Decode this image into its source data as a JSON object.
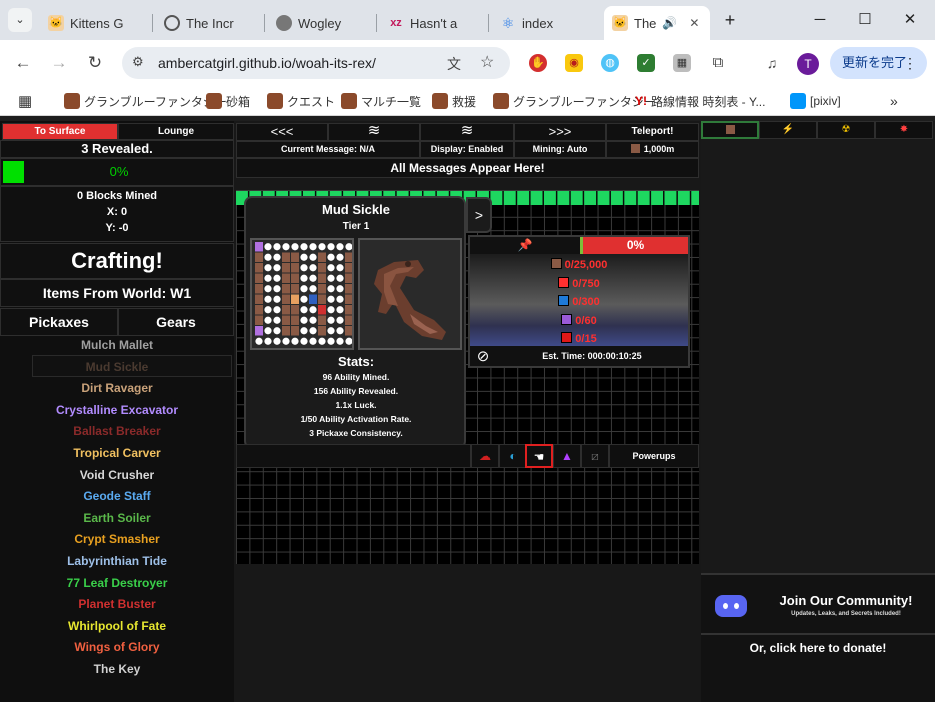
{
  "browser": {
    "tabs": [
      {
        "title": "Kittens G",
        "icon": "cat-icon"
      },
      {
        "title": "The Incr",
        "icon": "globe-icon"
      },
      {
        "title": "Wogley",
        "icon": "wogley-icon"
      },
      {
        "title": "Hasn't a",
        "icon": "xyz-icon"
      },
      {
        "title": "index",
        "icon": "react-icon"
      },
      {
        "title": "The",
        "icon": "cat-icon"
      }
    ],
    "new_tab": "+",
    "window_controls": {
      "minimize": "─",
      "maximize": "☐",
      "close": "✕"
    },
    "url": "ambercatgirl.github.io/woah-its-rex/",
    "profile_initial": "T",
    "update_button": "更新を完了",
    "bookmarks": [
      "グランブルーファンタジー",
      "砂箱",
      "クエスト",
      "マルチ一覧",
      "救援",
      "グランブルーファンタジー",
      "路線情報 時刻表 - Y...",
      "[pixiv]"
    ],
    "bookmarks_more": "»"
  },
  "left": {
    "to_surface": "To Surface",
    "lounge": "Lounge",
    "revealed": "3 Revealed.",
    "progress_text": "0%",
    "progress_value": 0,
    "blocks_mined": "0 Blocks Mined",
    "x": "X: 0",
    "y": "Y: -0",
    "crafting": "Crafting!",
    "items_from_world": "Items From World: W1",
    "tab_pickaxes": "Pickaxes",
    "tab_gears": "Gears",
    "pickaxes": [
      {
        "name": "Mulch Mallet",
        "color": "#a0a0a0"
      },
      {
        "name": "Mud Sickle",
        "color": "#4a3a30"
      },
      {
        "name": "Dirt Ravager",
        "color": "#c9a27a"
      },
      {
        "name": "Crystalline Excavator",
        "color": "#b28cff"
      },
      {
        "name": "Ballast Breaker",
        "color": "#8a2a2a"
      },
      {
        "name": "Tropical Carver",
        "color": "#f0c060"
      },
      {
        "name": "Void Crusher",
        "color": "#d8d8d8"
      },
      {
        "name": "Geode Staff",
        "color": "#5aaaf0"
      },
      {
        "name": "Earth Soiler",
        "color": "#5ab84a"
      },
      {
        "name": "Crypt Smasher",
        "color": "#e8a020"
      },
      {
        "name": "Labyrinthian Tide",
        "color": "#9ec0e8"
      },
      {
        "name": "77 Leaf Destroyer",
        "color": "#3ad04a"
      },
      {
        "name": "Planet Buster",
        "color": "#d03030"
      },
      {
        "name": "Whirlpool of Fate",
        "color": "#e8e830"
      },
      {
        "name": "Wings of Glory",
        "color": "#f06040"
      },
      {
        "name": "The Key",
        "color": "#d0d0d0"
      }
    ]
  },
  "top": {
    "nav_left": "<<<",
    "nav_down": "≋",
    "nav_up": "≋",
    "nav_right": ">>>",
    "teleport": "Teleport!",
    "current_message": "Current Message: N/A",
    "display": "Display: Enabled",
    "mining": "Mining: Auto",
    "depth": "1,000m",
    "all_messages": "All Messages Appear Here!"
  },
  "popup": {
    "title": "Mud Sickle",
    "tier": "Tier 1",
    "stats_header": "Stats:",
    "stats": [
      "96 Ability Mined.",
      "156 Ability Revealed.",
      "1.1x Luck.",
      "1/50 Ability Activation Rate.",
      "3 Pickaxe Consistency."
    ],
    "arrow": ">"
  },
  "ore_panel": {
    "progress": "0%",
    "ores": [
      {
        "count": "0/25,000",
        "color": "#8a5a45"
      },
      {
        "count": "0/750",
        "color": "#ff3030"
      },
      {
        "count": "0/300",
        "color": "#1e7ad8"
      },
      {
        "count": "0/60",
        "color": "#9a5ad8"
      },
      {
        "count": "0/15",
        "color": "#e01818"
      }
    ],
    "est_time": "Est. Time: 000:00:10:25"
  },
  "powerups": {
    "label": "Powerups"
  },
  "right": {
    "community_title": "Join Our Community!",
    "community_sub": "Updates, Leaks, and Secrets Included!",
    "donate": "Or, click here to donate!"
  }
}
